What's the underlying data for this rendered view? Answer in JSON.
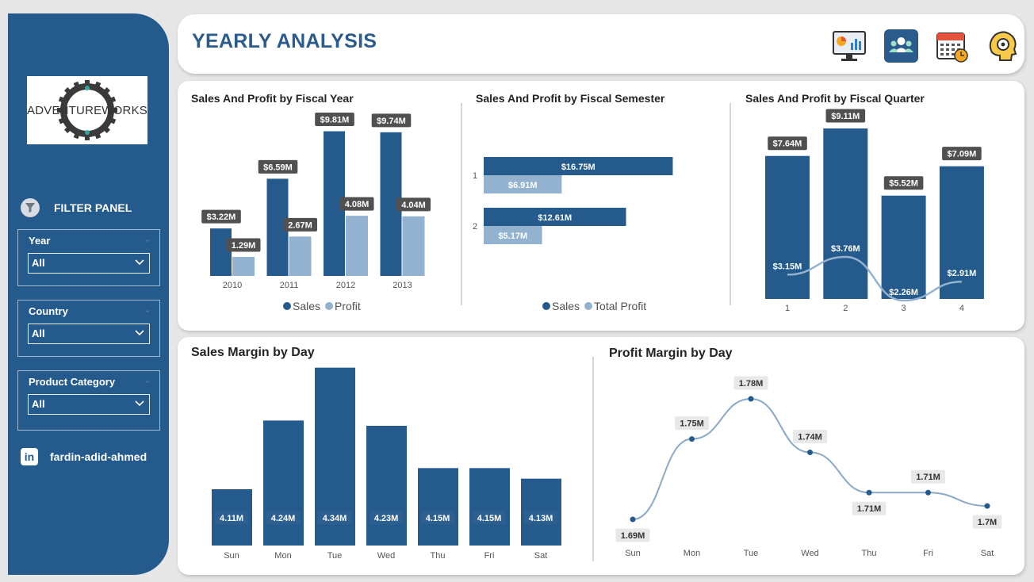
{
  "colors": {
    "sidebar": "#255a8c",
    "sales": "#255a8c",
    "profit": "#93b2cf",
    "label_dark": "#505050",
    "label_light": "#e8e8e8"
  },
  "header": {
    "title": "YEARLY ANALYSIS",
    "icons": [
      "dashboard-icon",
      "team-icon",
      "calendar-icon",
      "head-gear-icon"
    ]
  },
  "sidebar": {
    "logo_text": "ADVENTUREWORKS",
    "filter_title": "FILTER PANEL",
    "filters": [
      {
        "label": "Year",
        "value": "All"
      },
      {
        "label": "Country",
        "value": "All"
      },
      {
        "label": "Product Category",
        "value": "All"
      }
    ],
    "linkedin": "fardin-adid-ahmed"
  },
  "chart_data": [
    {
      "type": "bar",
      "title": "Sales And Profit by Fiscal Year",
      "categories": [
        "2010",
        "2011",
        "2012",
        "2013"
      ],
      "series": [
        {
          "name": "Sales",
          "values": [
            3.22,
            6.59,
            9.81,
            9.74
          ],
          "labels": [
            "$3.22M",
            "$6.59M",
            "$9.81M",
            "$9.74M"
          ]
        },
        {
          "name": "Profit",
          "values": [
            1.29,
            2.67,
            4.08,
            4.04
          ],
          "labels": [
            "1.29M",
            "2.67M",
            "4.08M",
            "4.04M"
          ]
        }
      ]
    },
    {
      "type": "bar",
      "orientation": "horizontal",
      "title": "Sales And Profit by Fiscal Semester",
      "categories": [
        "1",
        "2"
      ],
      "series": [
        {
          "name": "Sales",
          "values": [
            16.75,
            12.61
          ],
          "labels": [
            "$16.75M",
            "$12.61M"
          ]
        },
        {
          "name": "Total Profit",
          "values": [
            6.91,
            5.17
          ],
          "labels": [
            "$6.91M",
            "$5.17M"
          ]
        }
      ]
    },
    {
      "type": "bar",
      "title": "Sales And Profit by Fiscal Quarter",
      "categories": [
        "1",
        "2",
        "3",
        "4"
      ],
      "series": [
        {
          "name": "Sales",
          "values": [
            7.64,
            9.11,
            5.52,
            7.09
          ],
          "labels": [
            "$7.64M",
            "$9.11M",
            "$5.52M",
            "$7.09M"
          ]
        },
        {
          "name": "Profit",
          "values": [
            3.15,
            3.76,
            2.26,
            2.91
          ],
          "labels": [
            "$3.15M",
            "$3.76M",
            "$2.26M",
            "$2.91M"
          ]
        }
      ]
    },
    {
      "type": "bar",
      "title": "Sales Margin by Day",
      "categories": [
        "Sun",
        "Mon",
        "Tue",
        "Wed",
        "Thu",
        "Fri",
        "Sat"
      ],
      "values": [
        4.11,
        4.24,
        4.34,
        4.23,
        4.15,
        4.15,
        4.13
      ],
      "labels": [
        "4.11M",
        "4.24M",
        "4.34M",
        "4.23M",
        "4.15M",
        "4.15M",
        "4.13M"
      ]
    },
    {
      "type": "line",
      "title": "Profit Margin by Day",
      "categories": [
        "Sun",
        "Mon",
        "Tue",
        "Wed",
        "Thu",
        "Fri",
        "Sat"
      ],
      "values": [
        1.69,
        1.75,
        1.78,
        1.74,
        1.71,
        1.71,
        1.7
      ],
      "labels": [
        "1.69M",
        "1.75M",
        "1.78M",
        "1.74M",
        "1.71M",
        "1.71M",
        "1.7M"
      ]
    }
  ]
}
